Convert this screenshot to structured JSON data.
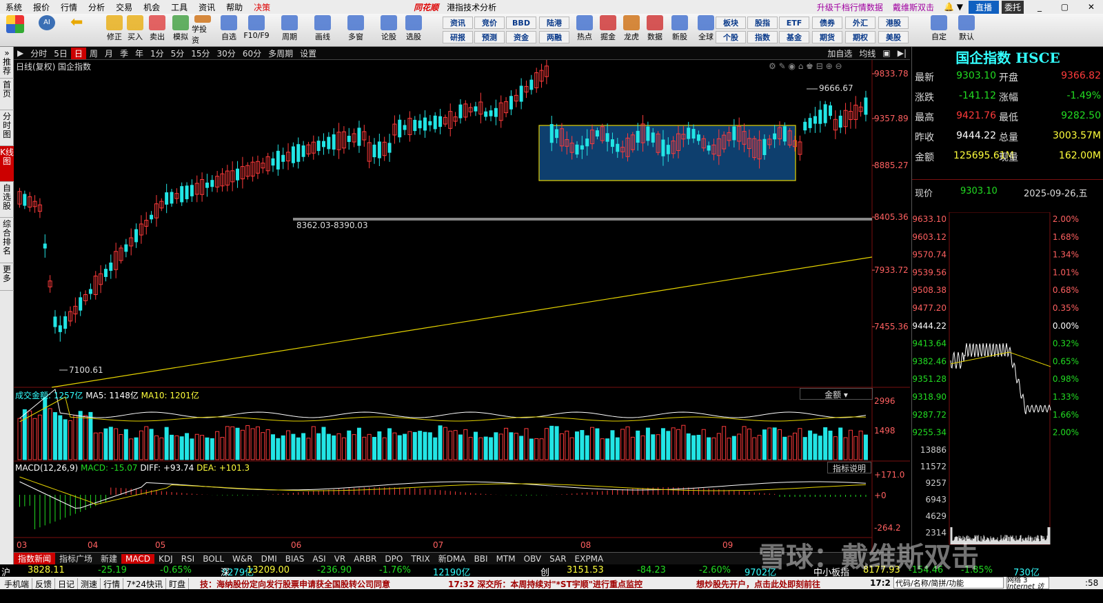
{
  "menu": {
    "items": [
      "系统",
      "报价",
      "行情",
      "分析",
      "交易",
      "机会",
      "工具",
      "资讯",
      "帮助",
      "决策"
    ],
    "brand": "同花顺",
    "title": "港指技术分析",
    "upgrade": "升级千档行情数据",
    "watermark_top": "戴维斯双击",
    "live": "直播",
    "entrust": "委托"
  },
  "toolbar": {
    "big": [
      "修正",
      "买入",
      "卖出",
      "模拟",
      "学投资",
      "自选",
      "F10/F9",
      "周期",
      "画线",
      "多窗",
      "论股",
      "选股",
      "热点",
      "掘金",
      "龙虎",
      "数据",
      "新股",
      "全球",
      "自定",
      "默认"
    ],
    "small_top": [
      "资讯",
      "竞价",
      "BBD",
      "陆港",
      "板块",
      "股指",
      "ETF",
      "债券",
      "外汇",
      "港股"
    ],
    "small_bot": [
      "研报",
      "预测",
      "资金",
      "两融",
      "个股",
      "指数",
      "基金",
      "期货",
      "期权",
      "美股"
    ]
  },
  "leftbar": [
    "推荐",
    "首页",
    "分时图",
    "K线图",
    "自选股",
    "综合排名",
    "更多"
  ],
  "period": {
    "items": [
      "分时",
      "5日",
      "日",
      "周",
      "月",
      "季",
      "年",
      "1分",
      "5分",
      "15分",
      "30分",
      "60分",
      "多周期",
      "设置"
    ],
    "active": "日",
    "right": [
      "加自选",
      "均线"
    ]
  },
  "chart": {
    "subtitle": "日线(复权)",
    "name": "国企指数",
    "high_label": "9666.67",
    "low_label": "7100.61",
    "range_label": "8362.03-8390.03",
    "price_ticks": [
      "9833.78",
      "9357.89",
      "8885.27",
      "8405.36",
      "7933.72",
      "7455.36"
    ],
    "months": [
      "03",
      "04",
      "05",
      "06",
      "07",
      "08",
      "09"
    ]
  },
  "volume": {
    "title": "成交金额: 1257亿",
    "ma5": "MA5: 1148亿",
    "ma10": "MA10: 1201亿",
    "selector": "金额",
    "ticks": [
      "2996",
      "1498"
    ]
  },
  "macd": {
    "title": "MACD(12,26,9)",
    "macd": "MACD: -15.07",
    "diff": "DIFF: +93.74",
    "dea": "DEA: +101.3",
    "btn": "指标说明",
    "ticks": [
      "+171.0",
      "+0",
      "-264.2"
    ]
  },
  "quote": {
    "title": "国企指数 HSCE",
    "rows": [
      [
        "最新",
        "9303.10",
        "开盘",
        "9366.82"
      ],
      [
        "涨跌",
        "-141.12",
        "涨幅",
        "-1.49%"
      ],
      [
        "最高",
        "9421.76",
        "最低",
        "9282.50"
      ],
      [
        "昨收",
        "9444.22",
        "总量",
        "3003.57M"
      ],
      [
        "金额",
        "125695.61M",
        "现量",
        "162.00M"
      ]
    ],
    "now_label": "现价",
    "now_val": "9303.10",
    "date": "2025-09-26,五"
  },
  "intraday": {
    "left_ticks": [
      "9633.10",
      "9603.12",
      "9570.74",
      "9539.56",
      "9508.38",
      "9477.20",
      "9444.22",
      "9413.64",
      "9382.46",
      "9351.28",
      "9318.90",
      "9287.72",
      "9255.34",
      "13886",
      "11572",
      "9257",
      "6943",
      "4629",
      "2314"
    ],
    "right_ticks": [
      "2.00%",
      "1.68%",
      "1.34%",
      "1.01%",
      "0.68%",
      "0.35%",
      "0.00%",
      "0.32%",
      "0.65%",
      "0.98%",
      "1.33%",
      "1.66%",
      "2.00%"
    ]
  },
  "bottomtabs": {
    "items": [
      "指数新闻",
      "指标广场",
      "新建",
      "MACD",
      "KDJ",
      "RSI",
      "BOLL",
      "W&R",
      "DMI",
      "BIAS",
      "ASI",
      "VR",
      "ARBR",
      "DPO",
      "TRIX",
      "新DMA",
      "BBI",
      "MTM",
      "OBV",
      "SAR",
      "EXPMA"
    ],
    "active": "MACD"
  },
  "indexbar": {
    "items": [
      [
        "沪",
        "3828.11",
        "-25.19",
        "-0.65%",
        "9279亿"
      ],
      [
        "深",
        "13209.00",
        "-236.90",
        "-1.76%",
        "12190亿"
      ],
      [
        "创",
        "3151.53",
        "-84.23",
        "-2.60%",
        "9702亿"
      ]
    ],
    "extra": [
      "中小板指",
      "8177.93",
      "-154.46",
      "-1.85%",
      "730亿"
    ]
  },
  "statusbar": {
    "left": [
      "手机端",
      "反馈",
      "日记",
      "测速",
      "行情",
      "7*24快讯",
      "盯盘"
    ],
    "news1": "技：海纳股份定向发行股票申请获全国股转公司同意",
    "news2": "17:32 深交所：本周持续对\"*ST宇顺\"进行重点监控",
    "news3": "想炒股先开户，点击此处即刻前往",
    "time": "17:2",
    "search": "代码/名称/简拼/功能",
    "net": "网络 3",
    "netsub": "Internet 访问",
    "clock": ":58"
  },
  "watermark": "雪球：戴维斯双击",
  "colors": {
    "up": "#ff3b3b",
    "down": "#22e5e5",
    "accent": "#c00000",
    "box": "#0e3f6e"
  }
}
